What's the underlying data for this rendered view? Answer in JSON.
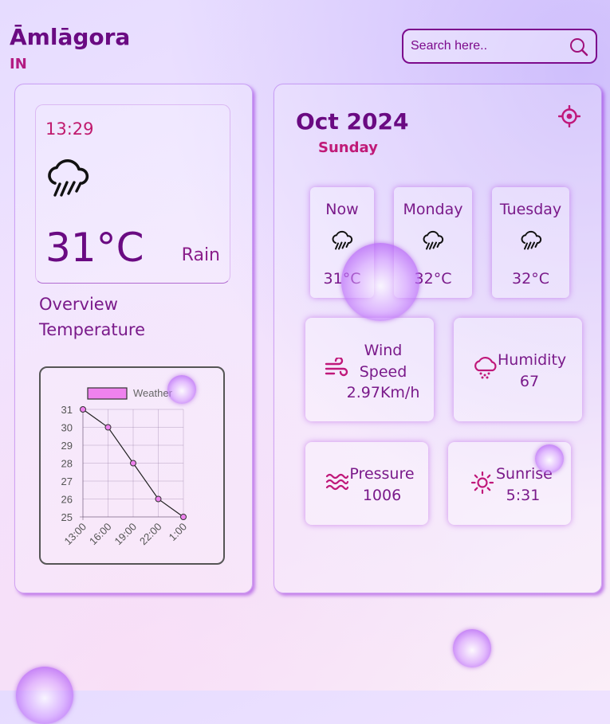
{
  "location": {
    "city": "Āmlāgora",
    "country": "IN"
  },
  "search": {
    "placeholder": "Search here.."
  },
  "current": {
    "time": "13:29",
    "temperature": "31°C",
    "condition": "Rain",
    "icon": "rain-cloud-icon"
  },
  "overview": {
    "line1": "Overview",
    "line2": "Temperature"
  },
  "chart_data": {
    "type": "line",
    "x": [
      "13:00",
      "16:00",
      "19:00",
      "22:00",
      "1:00"
    ],
    "series": [
      {
        "name": "Weather",
        "values": [
          31,
          30,
          28,
          26,
          25
        ]
      }
    ],
    "yticks": [
      31,
      30,
      29,
      28,
      27,
      26,
      25
    ],
    "ylim": [
      25,
      31
    ],
    "grid": true,
    "legend": "top",
    "colors": {
      "fill": "#ee82ee",
      "line": "#222222",
      "point": "#ee82ee"
    }
  },
  "date": {
    "month_year": "Oct 2024",
    "weekday": "Sunday"
  },
  "forecast": [
    {
      "name": "Now",
      "temp": "31°C",
      "icon": "rain-cloud-icon"
    },
    {
      "name": "Monday",
      "temp": "32°C",
      "icon": "rain-cloud-icon"
    },
    {
      "name": "Tuesday",
      "temp": "32°C",
      "icon": "rain-cloud-icon"
    }
  ],
  "stats": {
    "wind": {
      "label_line1": "Wind",
      "label_line2": "Speed",
      "value": "2.97Km/h",
      "icon": "wind-icon"
    },
    "humidity": {
      "label": "Humidity",
      "value": "67",
      "icon": "humidity-cloud-icon"
    },
    "pressure": {
      "label": "Pressure",
      "value": "1006",
      "icon": "waves-icon"
    },
    "sunrise": {
      "label": "Sunrise",
      "value": "5:31",
      "icon": "sun-icon"
    }
  },
  "colors": {
    "primary": "#6a0a82",
    "accent": "#c01a6e",
    "icon": "#c0187a"
  }
}
